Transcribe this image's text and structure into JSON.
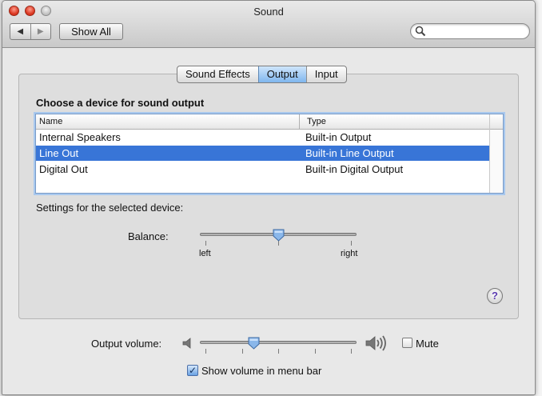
{
  "window": {
    "title": "Sound"
  },
  "toolbar": {
    "back_glyph": "◀",
    "forward_glyph": "▶",
    "show_all_label": "Show All",
    "search_placeholder": ""
  },
  "tabs": [
    {
      "label": "Sound Effects",
      "active": false
    },
    {
      "label": "Output",
      "active": true
    },
    {
      "label": "Input",
      "active": false
    }
  ],
  "output": {
    "heading": "Choose a device for sound output",
    "columns": [
      "Name",
      "Type"
    ],
    "devices": [
      {
        "name": "Internal Speakers",
        "type": "Built-in Output",
        "selected": false
      },
      {
        "name": "Line Out",
        "type": "Built-in Line Output",
        "selected": true
      },
      {
        "name": "Digital Out",
        "type": "Built-in Digital Output",
        "selected": false
      }
    ],
    "settings_label": "Settings for the selected device:",
    "balance": {
      "label": "Balance:",
      "left_label": "left",
      "right_label": "right",
      "value": 0.5
    }
  },
  "help": {
    "glyph": "?"
  },
  "volume": {
    "label": "Output volume:",
    "level": 0.33,
    "mute_label": "Mute",
    "mute_checked": false,
    "show_in_menu_bar_label": "Show volume in menu bar",
    "show_in_menu_bar_checked": true,
    "check_glyph": "✓"
  },
  "colors": {
    "selection": "#3875d7",
    "tab_active": "#7fb6ee"
  }
}
